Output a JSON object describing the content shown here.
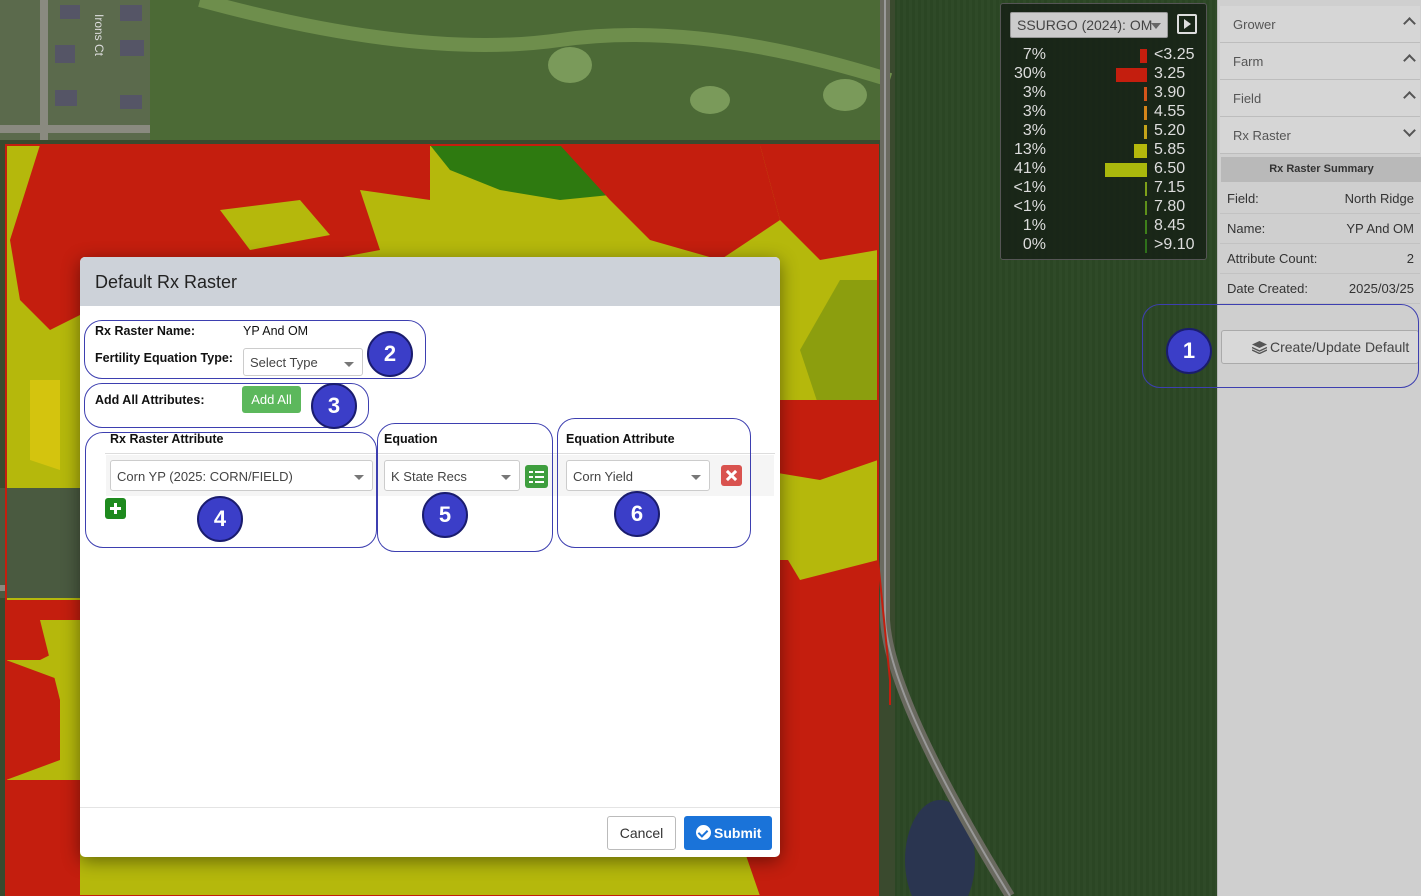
{
  "map": {
    "street_label": "Irons Ct",
    "colors": {
      "red": "#c41e0e",
      "orange": "#d47a10",
      "yellow": "#b5b80c",
      "olive": "#8c9e0e",
      "green": "#2e7a10",
      "field_border": "#c41e0e"
    }
  },
  "legend": {
    "layer": "SSURGO (2024): OM",
    "rows": [
      {
        "pct": "7%",
        "val": "<3.25",
        "color": "#c41e0e",
        "w": 7
      },
      {
        "pct": "30%",
        "val": "3.25",
        "color": "#c41e0e",
        "w": 30
      },
      {
        "pct": "3%",
        "val": "3.90",
        "color": "#d4551a",
        "w": 3
      },
      {
        "pct": "3%",
        "val": "4.55",
        "color": "#d4851a",
        "w": 3
      },
      {
        "pct": "3%",
        "val": "5.20",
        "color": "#c4a31a",
        "w": 3
      },
      {
        "pct": "13%",
        "val": "5.85",
        "color": "#b5b80c",
        "w": 13
      },
      {
        "pct": "41%",
        "val": "6.50",
        "color": "#aab80c",
        "w": 41
      },
      {
        "pct": "<1%",
        "val": "7.15",
        "color": "#7ea01a",
        "w": 1
      },
      {
        "pct": "<1%",
        "val": "7.80",
        "color": "#5e901a",
        "w": 1
      },
      {
        "pct": "1%",
        "val": "8.45",
        "color": "#3e801a",
        "w": 1
      },
      {
        "pct": "0%",
        "val": ">9.10",
        "color": "#2e701a",
        "w": 1
      }
    ]
  },
  "sidebar": {
    "items": [
      {
        "label": "Grower",
        "open": false
      },
      {
        "label": "Farm",
        "open": false
      },
      {
        "label": "Field",
        "open": false
      },
      {
        "label": "Rx Raster",
        "open": true
      }
    ],
    "summary_title": "Rx Raster Summary",
    "summary": [
      {
        "key": "Field:",
        "value": "North Ridge"
      },
      {
        "key": "Name:",
        "value": "YP And OM"
      },
      {
        "key": "Attribute Count:",
        "value": "2"
      },
      {
        "key": "Date Created:",
        "value": "2025/03/25"
      }
    ],
    "create_button": "Create/Update Default"
  },
  "dialog": {
    "title": "Default Rx Raster",
    "name_label": "Rx Raster Name:",
    "name_value": "YP And OM",
    "fert_label": "Fertility Equation Type:",
    "fert_select": "Select Type",
    "add_all_label": "Add All Attributes:",
    "add_all_button": "Add All",
    "col_attr": "Rx Raster Attribute",
    "col_equation": "Equation",
    "col_eq_attr": "Equation Attribute",
    "row": {
      "attribute": "Corn YP (2025: CORN/FIELD)",
      "equation": "K State Recs",
      "eq_attribute": "Corn Yield"
    },
    "cancel": "Cancel",
    "submit": "Submit"
  },
  "annotations": [
    "1",
    "2",
    "3",
    "4",
    "5",
    "6"
  ],
  "annotation_color": "#3b3ec8"
}
